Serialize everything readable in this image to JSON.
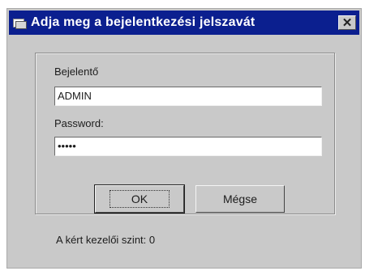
{
  "window": {
    "title": "Adja meg a bejelentkezési jelszavát",
    "close_label": "✕"
  },
  "form": {
    "user_label": "Bejelentő",
    "user_value": "ADMIN",
    "password_label": "Password:",
    "password_value": "•••••"
  },
  "buttons": {
    "ok_label": "OK",
    "cancel_label": "Mégse"
  },
  "status": {
    "text": "A kért kezelői szint: 0"
  },
  "colors": {
    "titlebar": "#0b1f8f",
    "window_bg": "#c9c9c9"
  }
}
